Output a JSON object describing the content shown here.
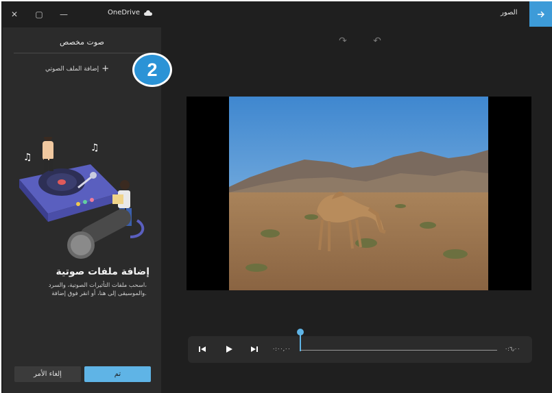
{
  "window": {
    "onedrive_label": "OneDrive",
    "app_title": "الصور",
    "controls": [
      "✕",
      "▢",
      "—"
    ]
  },
  "panel": {
    "title": "صوت مخصص",
    "add_audio_label": "إضافة الملف الصوتي",
    "badge_number": "2",
    "empty_title": "إضافة ملفات صوتية",
    "empty_desc_line1": "اسحب ملفات التأثيرات الصوتية، والسرد،",
    "empty_desc_line2": "والموسيقى إلى هنا، أو انقر فوق إضافة.",
    "done_label": "تم",
    "cancel_label": "إلغاء الأمر"
  },
  "playback": {
    "current_time": "٠:٠٠,٠٠",
    "end_time": "٠:٦٫٠٠"
  },
  "colors": {
    "accent": "#3d9bd8",
    "badge": "#2b93d6",
    "panel_bg": "#2b2b2b",
    "app_bg": "#1f1f1f"
  }
}
